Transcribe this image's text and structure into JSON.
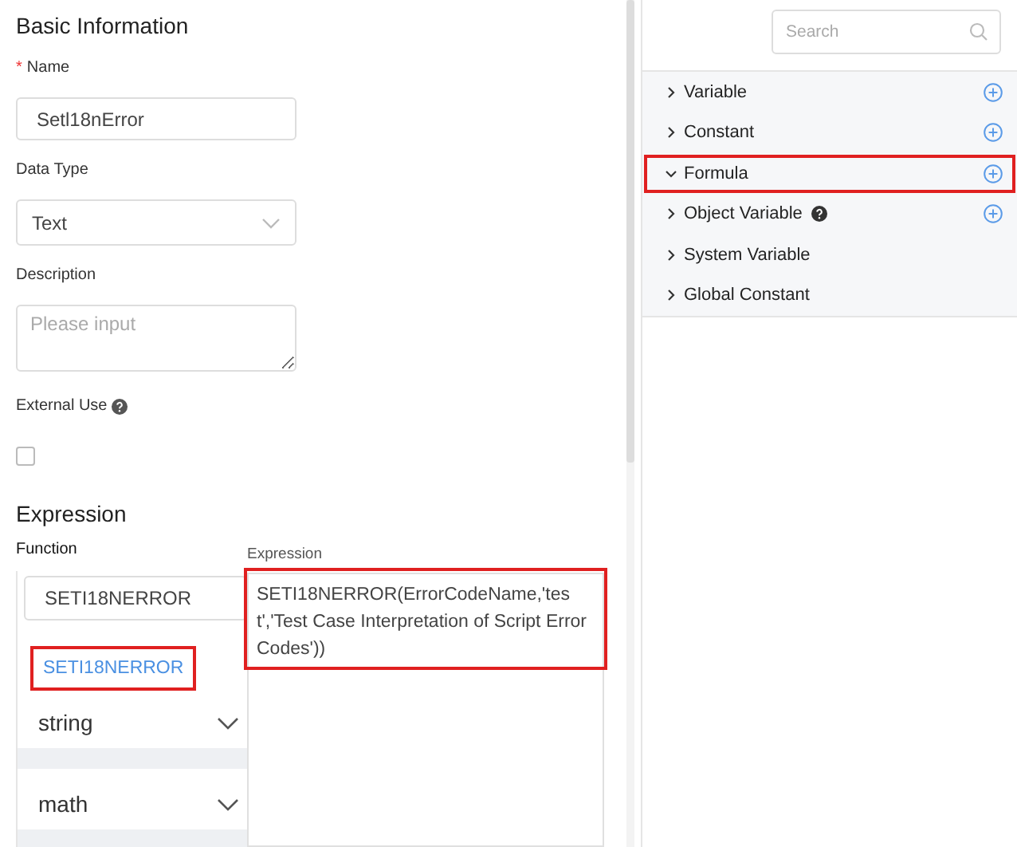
{
  "basic": {
    "title": "Basic Information",
    "name": {
      "label": "Name",
      "required": true,
      "required_mark": "*",
      "value": "Setl18nError"
    },
    "data_type": {
      "label": "Data Type",
      "value": "Text"
    },
    "description": {
      "label": "Description",
      "placeholder": "Please input"
    },
    "external_use": {
      "label": "External Use",
      "checked": false
    }
  },
  "expression": {
    "title": "Expression",
    "function": {
      "label": "Function",
      "search_value": "SETI18NERROR",
      "items": [
        {
          "kind": "function",
          "label": "SETI18NERROR",
          "selected": true,
          "highlighted": true
        },
        {
          "kind": "group",
          "label": "string",
          "expanded": false
        },
        {
          "kind": "group",
          "label": "math",
          "expanded": false
        }
      ]
    },
    "editor": {
      "label": "Expression",
      "value": "SETI18NERROR(ErrorCodeName,'test','Test Case Interpretation of Script Error Codes'))",
      "highlighted": true
    }
  },
  "sidebar": {
    "search": {
      "placeholder": "Search"
    },
    "items": [
      {
        "label": "Variable",
        "expanded": false,
        "addable": true,
        "help": false,
        "highlighted": false
      },
      {
        "label": "Constant",
        "expanded": false,
        "addable": true,
        "help": false,
        "highlighted": false
      },
      {
        "label": "Formula",
        "expanded": true,
        "addable": true,
        "help": false,
        "highlighted": true
      },
      {
        "label": "Object Variable",
        "expanded": false,
        "addable": true,
        "help": true,
        "highlighted": false
      },
      {
        "label": "System Variable",
        "expanded": false,
        "addable": false,
        "help": false,
        "highlighted": false
      },
      {
        "label": "Global Constant",
        "expanded": false,
        "addable": false,
        "help": false,
        "highlighted": false
      }
    ]
  }
}
